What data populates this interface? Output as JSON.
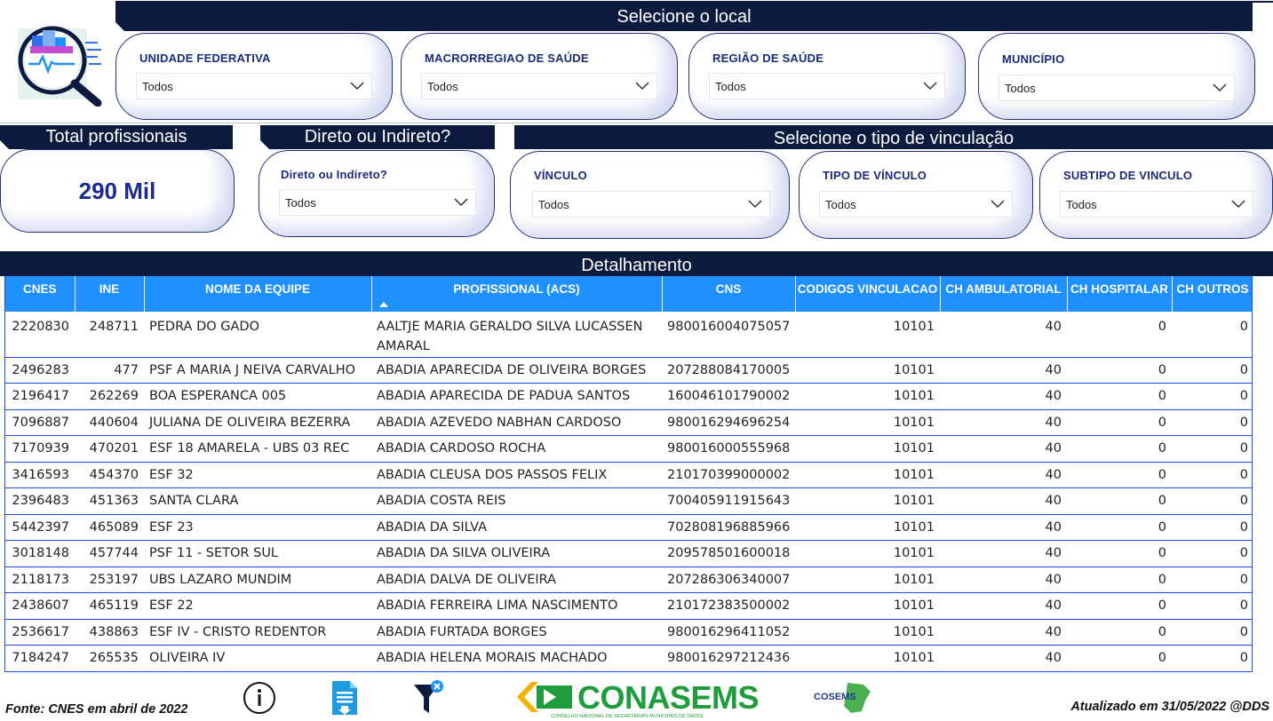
{
  "header": {
    "local_banner": "Selecione o local",
    "total_banner": "Total profissionais",
    "direto_banner": "Direto ou Indireto?",
    "vinculacao_banner": "Selecione o tipo de vinculação",
    "detail_banner": "Detalhamento"
  },
  "filters_local": [
    {
      "title": "UNIDADE FEDERATIVA",
      "value": "Todos"
    },
    {
      "title": "MACRORREGIAO DE SAÚDE",
      "value": "Todos"
    },
    {
      "title": "REGIÃO DE SAÚDE",
      "value": "Todos"
    },
    {
      "title": "MUNICÍPIO",
      "value": "Todos"
    }
  ],
  "kpi": {
    "total_value": "290 Mil"
  },
  "filter_direto": {
    "title": "Direto ou Indireto?",
    "value": "Todos"
  },
  "filters_vinculo": [
    {
      "title": "VÍNCULO",
      "value": "Todos"
    },
    {
      "title": "TIPO DE VÍNCULO",
      "value": "Todos"
    },
    {
      "title": "SUBTIPO DE VINCULO",
      "value": "Todos"
    }
  ],
  "table": {
    "columns": [
      "CNES",
      "INE",
      "NOME DA EQUIPE",
      "PROFISSIONAL (ACS)",
      "CNS",
      "CODIGOS VINCULACAO",
      "CH AMBULATORIAL",
      "CH HOSPITALAR",
      "CH OUTROS"
    ],
    "rows": [
      [
        "2220830",
        "248711",
        "PEDRA DO GADO",
        "AALTJE MARIA GERALDO SILVA LUCASSEN AMARAL",
        "980016004075057",
        "10101",
        "40",
        "0",
        "0"
      ],
      [
        "2496283",
        "477",
        "PSF A MARIA J NEIVA CARVALHO",
        "ABADIA APARECIDA DE OLIVEIRA BORGES",
        "207288084170005",
        "10101",
        "40",
        "0",
        "0"
      ],
      [
        "2196417",
        "262269",
        "BOA ESPERANCA 005",
        "ABADIA APARECIDA DE PADUA SANTOS",
        "160046101790002",
        "10101",
        "40",
        "0",
        "0"
      ],
      [
        "7096887",
        "440604",
        "JULIANA DE OLIVEIRA BEZERRA",
        "ABADIA AZEVEDO NABHAN CARDOSO",
        "980016294696254",
        "10101",
        "40",
        "0",
        "0"
      ],
      [
        "7170939",
        "470201",
        "ESF 18 AMARELA - UBS 03 REC",
        "ABADIA CARDOSO ROCHA",
        "980016000555968",
        "10101",
        "40",
        "0",
        "0"
      ],
      [
        "3416593",
        "454370",
        "ESF 32",
        "ABADIA CLEUSA DOS PASSOS FELIX",
        "210170399000002",
        "10101",
        "40",
        "0",
        "0"
      ],
      [
        "2396483",
        "451363",
        "SANTA CLARA",
        "ABADIA COSTA REIS",
        "700405911915643",
        "10101",
        "40",
        "0",
        "0"
      ],
      [
        "5442397",
        "465089",
        "ESF 23",
        "ABADIA DA SILVA",
        "702808196885966",
        "10101",
        "40",
        "0",
        "0"
      ],
      [
        "3018148",
        "457744",
        "PSF 11 - SETOR SUL",
        "ABADIA DA SILVA OLIVEIRA",
        "209578501600018",
        "10101",
        "40",
        "0",
        "0"
      ],
      [
        "2118173",
        "253197",
        "UBS LAZARO MUNDIM",
        "ABADIA DALVA DE OLIVEIRA",
        "207286306340007",
        "10101",
        "40",
        "0",
        "0"
      ],
      [
        "2438607",
        "465119",
        "ESF 22",
        "ABADIA FERREIRA LIMA NASCIMENTO",
        "210172383500002",
        "10101",
        "40",
        "0",
        "0"
      ],
      [
        "2536617",
        "438863",
        "ESF IV - CRISTO REDENTOR",
        "ABADIA FURTADA BORGES",
        "980016296411052",
        "10101",
        "40",
        "0",
        "0"
      ],
      [
        "7184247",
        "265535",
        "OLIVEIRA IV",
        "ABADIA HELENA MORAIS MACHADO",
        "980016297212436",
        "10101",
        "40",
        "0",
        "0"
      ]
    ]
  },
  "footer": {
    "source": "Fonte: CNES em abril de 2022",
    "updated": "Atualizado em 31/05/2022 @DDS",
    "conasems_logo_text": "CONASEMS",
    "conasems_tagline": "CONSELHO NACIONAL DE SECRETARIAS MUNICIPAIS DE SAÚDE",
    "cosems_logo_text": "COSEMS"
  },
  "icons": {
    "app_logo": "magnifier-chart-icon",
    "info": "info-icon",
    "export": "document-export-icon",
    "clear_filters": "clear-filter-icon"
  }
}
